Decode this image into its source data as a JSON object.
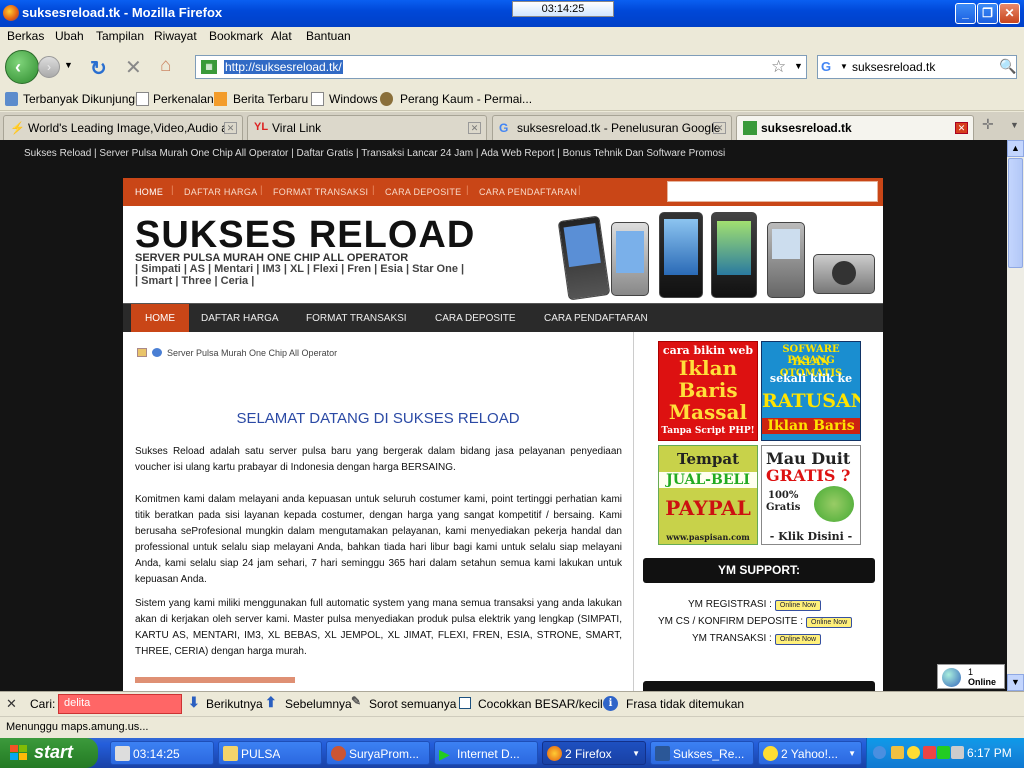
{
  "window": {
    "title": "suksesreload.tk - Mozilla Firefox",
    "clock_overlay": "03:14:25"
  },
  "menu": [
    "Berkas",
    "Ubah",
    "Tampilan",
    "Riwayat",
    "Bookmark",
    "Alat",
    "Bantuan"
  ],
  "navbar": {
    "url": "http://suksesreload.tk/",
    "search_value": "suksesreload.tk"
  },
  "bookmarks": [
    "Terbanyak Dikunjungi",
    "Perkenalan",
    "Berita Terbaru",
    "Windows",
    "Perang Kaum - Permai..."
  ],
  "tabs": [
    {
      "label": "World's Leading Image,Video,Audio a...",
      "active": false
    },
    {
      "label": "Viral Link",
      "active": false
    },
    {
      "label": "suksesreload.tk - Penelusuran Google",
      "active": false
    },
    {
      "label": "suksesreload.tk",
      "active": true
    }
  ],
  "page": {
    "tagline": "Sukses Reload | Server Pulsa Murah One Chip All Operator | Daftar Gratis | Transaksi Lancar 24 Jam | Ada Web Report | Bonus Tehnik Dan Software Promosi",
    "top_nav": [
      "HOME",
      "DAFTAR HARGA",
      "FORMAT TRANSAKSI",
      "CARA DEPOSITE",
      "CARA PENDAFTARAN"
    ],
    "logo_title": "SUKSES RELOAD",
    "logo_sub": "SERVER PULSA MURAH ONE CHIP ALL OPERATOR",
    "operators_line1": "| Simpati | AS | Mentari | IM3 | XL | Flexi | Fren | Esia | Star One |",
    "operators_line2": "| Smart | Three | Ceria |",
    "main_nav": [
      "HOME",
      "DAFTAR HARGA",
      "FORMAT TRANSAKSI",
      "CARA DEPOSITE",
      "CARA PENDAFTARAN"
    ],
    "breadcrumb": "Server Pulsa Murah One Chip All Operator",
    "welcome": "SELAMAT DATANG DI SUKSES RELOAD",
    "paragraphs": [
      "Sukses Reload adalah satu server pulsa baru yang bergerak dalam bidang jasa pelayanan penyediaan voucher isi ulang kartu prabayar di Indonesia dengan harga BERSAING.",
      "Komitmen kami dalam melayani anda kepuasan untuk seluruh costumer kami, point tertinggi perhatian kami titik beratkan pada sisi layanan kepada costumer, dengan harga yang sangat kompetitif / bersaing. Kami berusaha seProfesional mungkin dalam mengutamakan pelayanan, kami menyediakan pekerja handal dan professional untuk selalu siap melayani Anda, bahkan tiada hari libur bagi kami untuk selalu siap melayani Anda, kami selalu siap 24 jam sehari, 7 hari seminggu 365 hari dalam setahun semua kami lakukan untuk kepuasan Anda.",
      "Sistem yang kami miliki menggunakan full automatic system yang mana semua transaksi yang anda lakukan akan di kerjakan oleh server kami. Master pulsa menyediakan produk pulsa elektrik yang lengkap (SIMPATI, KARTU AS, MENTARI, IM3, XL BEBAS, XL JEMPOL, XL JIMAT, FLEXI, FREN, ESIA, STRONE, SMART, THREE, CERIA) dengan harga murah."
    ],
    "ads": {
      "ad1": [
        "cara bikin web",
        "Iklan",
        "Baris",
        "Massal",
        "Tanpa Script PHP!"
      ],
      "ad2": [
        "SOFWARE PASANG",
        "IKLAN OTOMATIS",
        "sekali klik ke",
        "RATUSAN",
        "Iklan Baris"
      ],
      "ad3": [
        "Tempat",
        "JUAL-BELI",
        "PAYPAL",
        "www.paspisan.com"
      ],
      "ad4": [
        "Mau Duit",
        "GRATIS ?",
        "100%",
        "Gratis",
        "- Klik Disini -"
      ]
    },
    "ym": {
      "header": "YM SUPPORT:",
      "rows": [
        "YM REGISTRASI :",
        "YM CS / KONFIRM DEPOSITE :",
        "YM TRANSAKSI :"
      ],
      "button": "Online Now"
    },
    "online_widget": {
      "count": "1",
      "label": "Online"
    }
  },
  "findbar": {
    "label": "Cari:",
    "value": "delita",
    "next": "Berikutnya",
    "prev": "Sebelumnya",
    "highlight": "Sorot semuanya",
    "match_case": "Cocokkan BESAR/kecil",
    "message": "Frasa tidak ditemukan"
  },
  "status": "Menunggu maps.amung.us...",
  "taskbar": {
    "start": "start",
    "tasks": [
      {
        "label": "03:14:25"
      },
      {
        "label": "PULSA"
      },
      {
        "label": "SuryaProm..."
      },
      {
        "label": "Internet D..."
      },
      {
        "label": "2 Firefox"
      },
      {
        "label": "Sukses_Re..."
      },
      {
        "label": "2 Yahoo!..."
      }
    ],
    "time": "6:17 PM"
  },
  "colors": {
    "accent": "#c94617",
    "xp_blue": "#245edb",
    "link_blue": "#2b4aa5"
  }
}
